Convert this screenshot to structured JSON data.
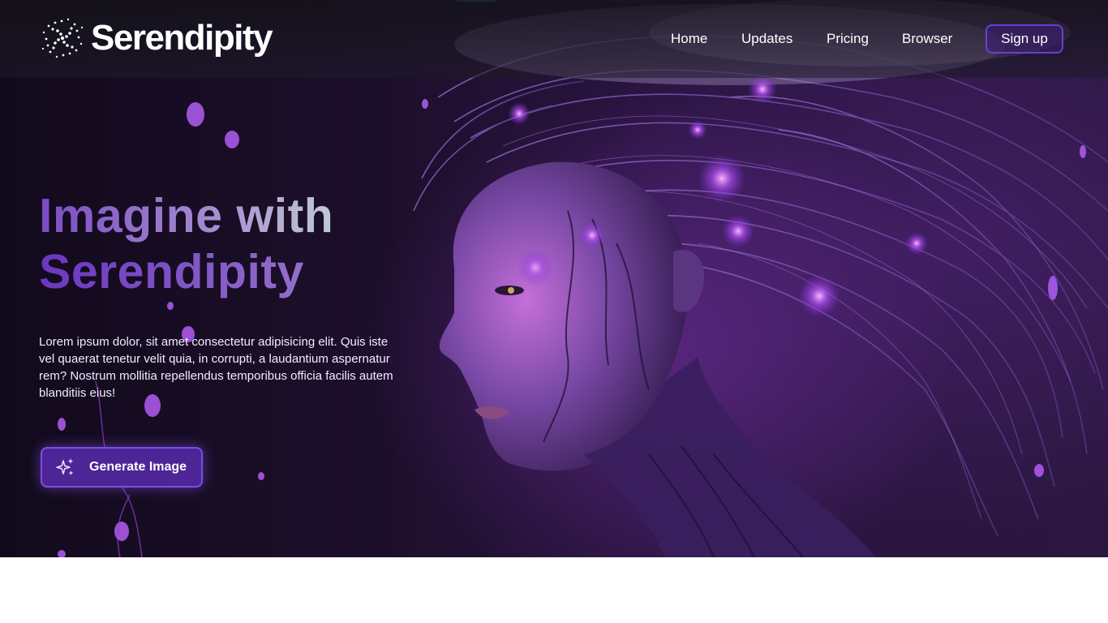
{
  "brand": {
    "name": "Serendipity",
    "logo_icon": "spiral-dots-logo"
  },
  "nav": {
    "items": [
      {
        "label": "Home"
      },
      {
        "label": "Updates"
      },
      {
        "label": "Pricing"
      },
      {
        "label": "Browser"
      }
    ],
    "signup_label": "Sign up"
  },
  "hero": {
    "heading_line1": "Imagine with",
    "heading_line2": "Serendipity",
    "description": "Lorem ipsum dolor, sit amet consectetur adipisicing elit. Quis iste vel quaerat tenetur velit quia, in corrupti, a laudantium aspernatur rem? Nostrum mollitia repellendus temporibus officia facilis autem blanditiis eius!",
    "cta_label": "Generate Image",
    "cta_icon": "sparkles-icon"
  },
  "colors": {
    "accent": "#6a3fd0",
    "button_fill": "#4d2596",
    "hero_background": "#1d0f2c",
    "progress_indicator": "#1fb36a"
  }
}
